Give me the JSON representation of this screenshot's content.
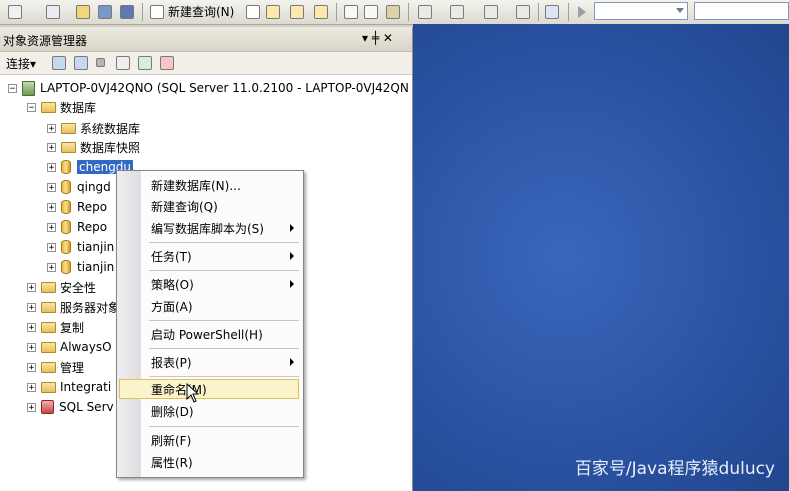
{
  "toolbar": {
    "new_query_label": "新建查询(N)"
  },
  "panel": {
    "title": "对象资源管理器",
    "pin": "▾ ╪ ✕",
    "connect_label": "连接▾"
  },
  "tree": {
    "server_label": "LAPTOP-0VJ42QNO (SQL Server 11.0.2100 - LAPTOP-0VJ42QN",
    "databases": "数据库",
    "system_db": "系统数据库",
    "db_snapshots": "数据库快照",
    "items": [
      "chengdu",
      "qingd",
      "Repo",
      "Repo",
      "tianjin",
      "tianjin"
    ],
    "security": "安全性",
    "server_objects": "服务器对象",
    "replication": "复制",
    "alwayson": "AlwaysO",
    "management": "管理",
    "integration": "Integrati",
    "sql_server": "SQL Serv"
  },
  "menu": {
    "new_db": "新建数据库(N)...",
    "new_query": "新建查询(Q)",
    "script_db": "编写数据库脚本为(S)",
    "tasks": "任务(T)",
    "policy": "策略(O)",
    "facets": "方面(A)",
    "powershell": "启动 PowerShell(H)",
    "reports": "报表(P)",
    "rename": "重命名(M)",
    "delete": "删除(D)",
    "refresh": "刷新(F)",
    "properties": "属性(R)"
  },
  "watermark": "百家号/Java程序猿dulucy"
}
